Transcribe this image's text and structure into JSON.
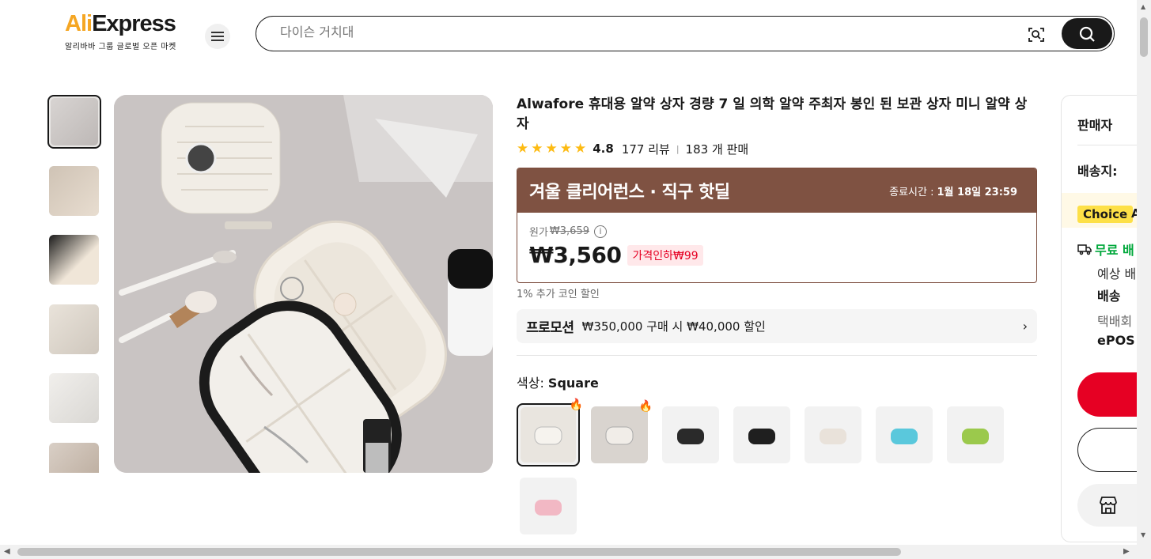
{
  "header": {
    "logo_text_pre": "Ali",
    "logo_text_post": "Express",
    "logo_sub": "알리바바 그룹 글로벌 오픈 마켓",
    "search_placeholder": "다이슨 거치대"
  },
  "product": {
    "title": "Alwafore 휴대용 알약 상자 경량 7 일 의학 알약 주최자 봉인 된 보관 상자 미니 알약 상자",
    "rating": "4.8",
    "reviews": "177 리뷰",
    "sold": "183 개 판매",
    "deal_title": "겨울 클리어런스 · 직구 핫딜",
    "deal_end_label": "종료시간 :",
    "deal_end_time": "1월 18일 23:59",
    "orig_label": "원가",
    "orig_price": "₩3,659",
    "price": "₩3,560",
    "discount": "가격인하₩99",
    "coin": "1% 추가 코인 할인",
    "promo_tag": "프로모션",
    "promo_text": "₩350,000 구매 시 ₩40,000 할인",
    "color_label": "색상: ",
    "color_value": "Square",
    "swatch_colors": [
      "#eceae6",
      "#e7e4e0",
      "#2a2a2a",
      "#1f1f1f",
      "#e9e2da",
      "#5ac8dc",
      "#9bc94c",
      "#f2b8c4"
    ]
  },
  "right_panel": {
    "seller": "판매자",
    "ship_to": "배송지:",
    "choice": "Choice",
    "choice_after": "A",
    "free_ship": "무료 배",
    "line1": "예상 배",
    "line2": "배송",
    "line3": "택배회",
    "line4": "ePOS"
  },
  "colors": {
    "accent_red": "#e60023",
    "deal_brown": "#7f5242",
    "star": "#fdbb13",
    "free_green": "#00a83b"
  }
}
